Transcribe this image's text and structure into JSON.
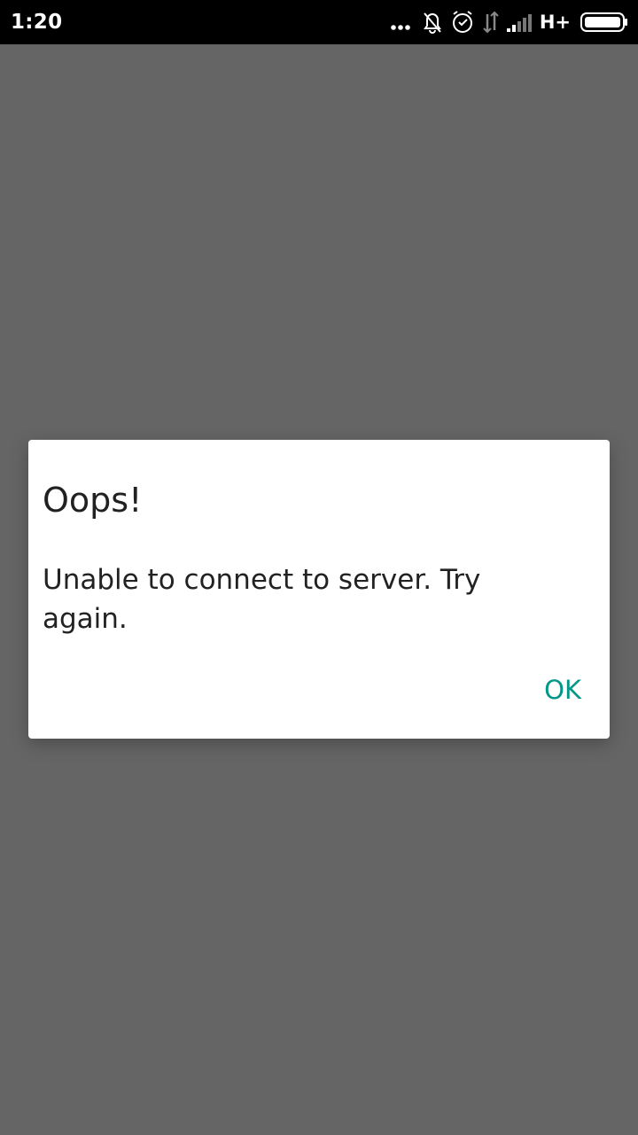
{
  "status_bar": {
    "time": "1:20",
    "network_type": "H+",
    "icons": [
      "more-dots-icon",
      "notifications-off-icon",
      "alarm-icon",
      "data-arrows-icon",
      "signal-icon",
      "battery-icon"
    ]
  },
  "dialog": {
    "title": "Oops!",
    "message": "Unable to connect to server. Try again.",
    "ok_label": "OK"
  },
  "colors": {
    "status_bar_bg": "#000000",
    "scrim": "#656565",
    "dialog_bg": "#ffffff",
    "title_text": "#212121",
    "accent": "#009688"
  }
}
